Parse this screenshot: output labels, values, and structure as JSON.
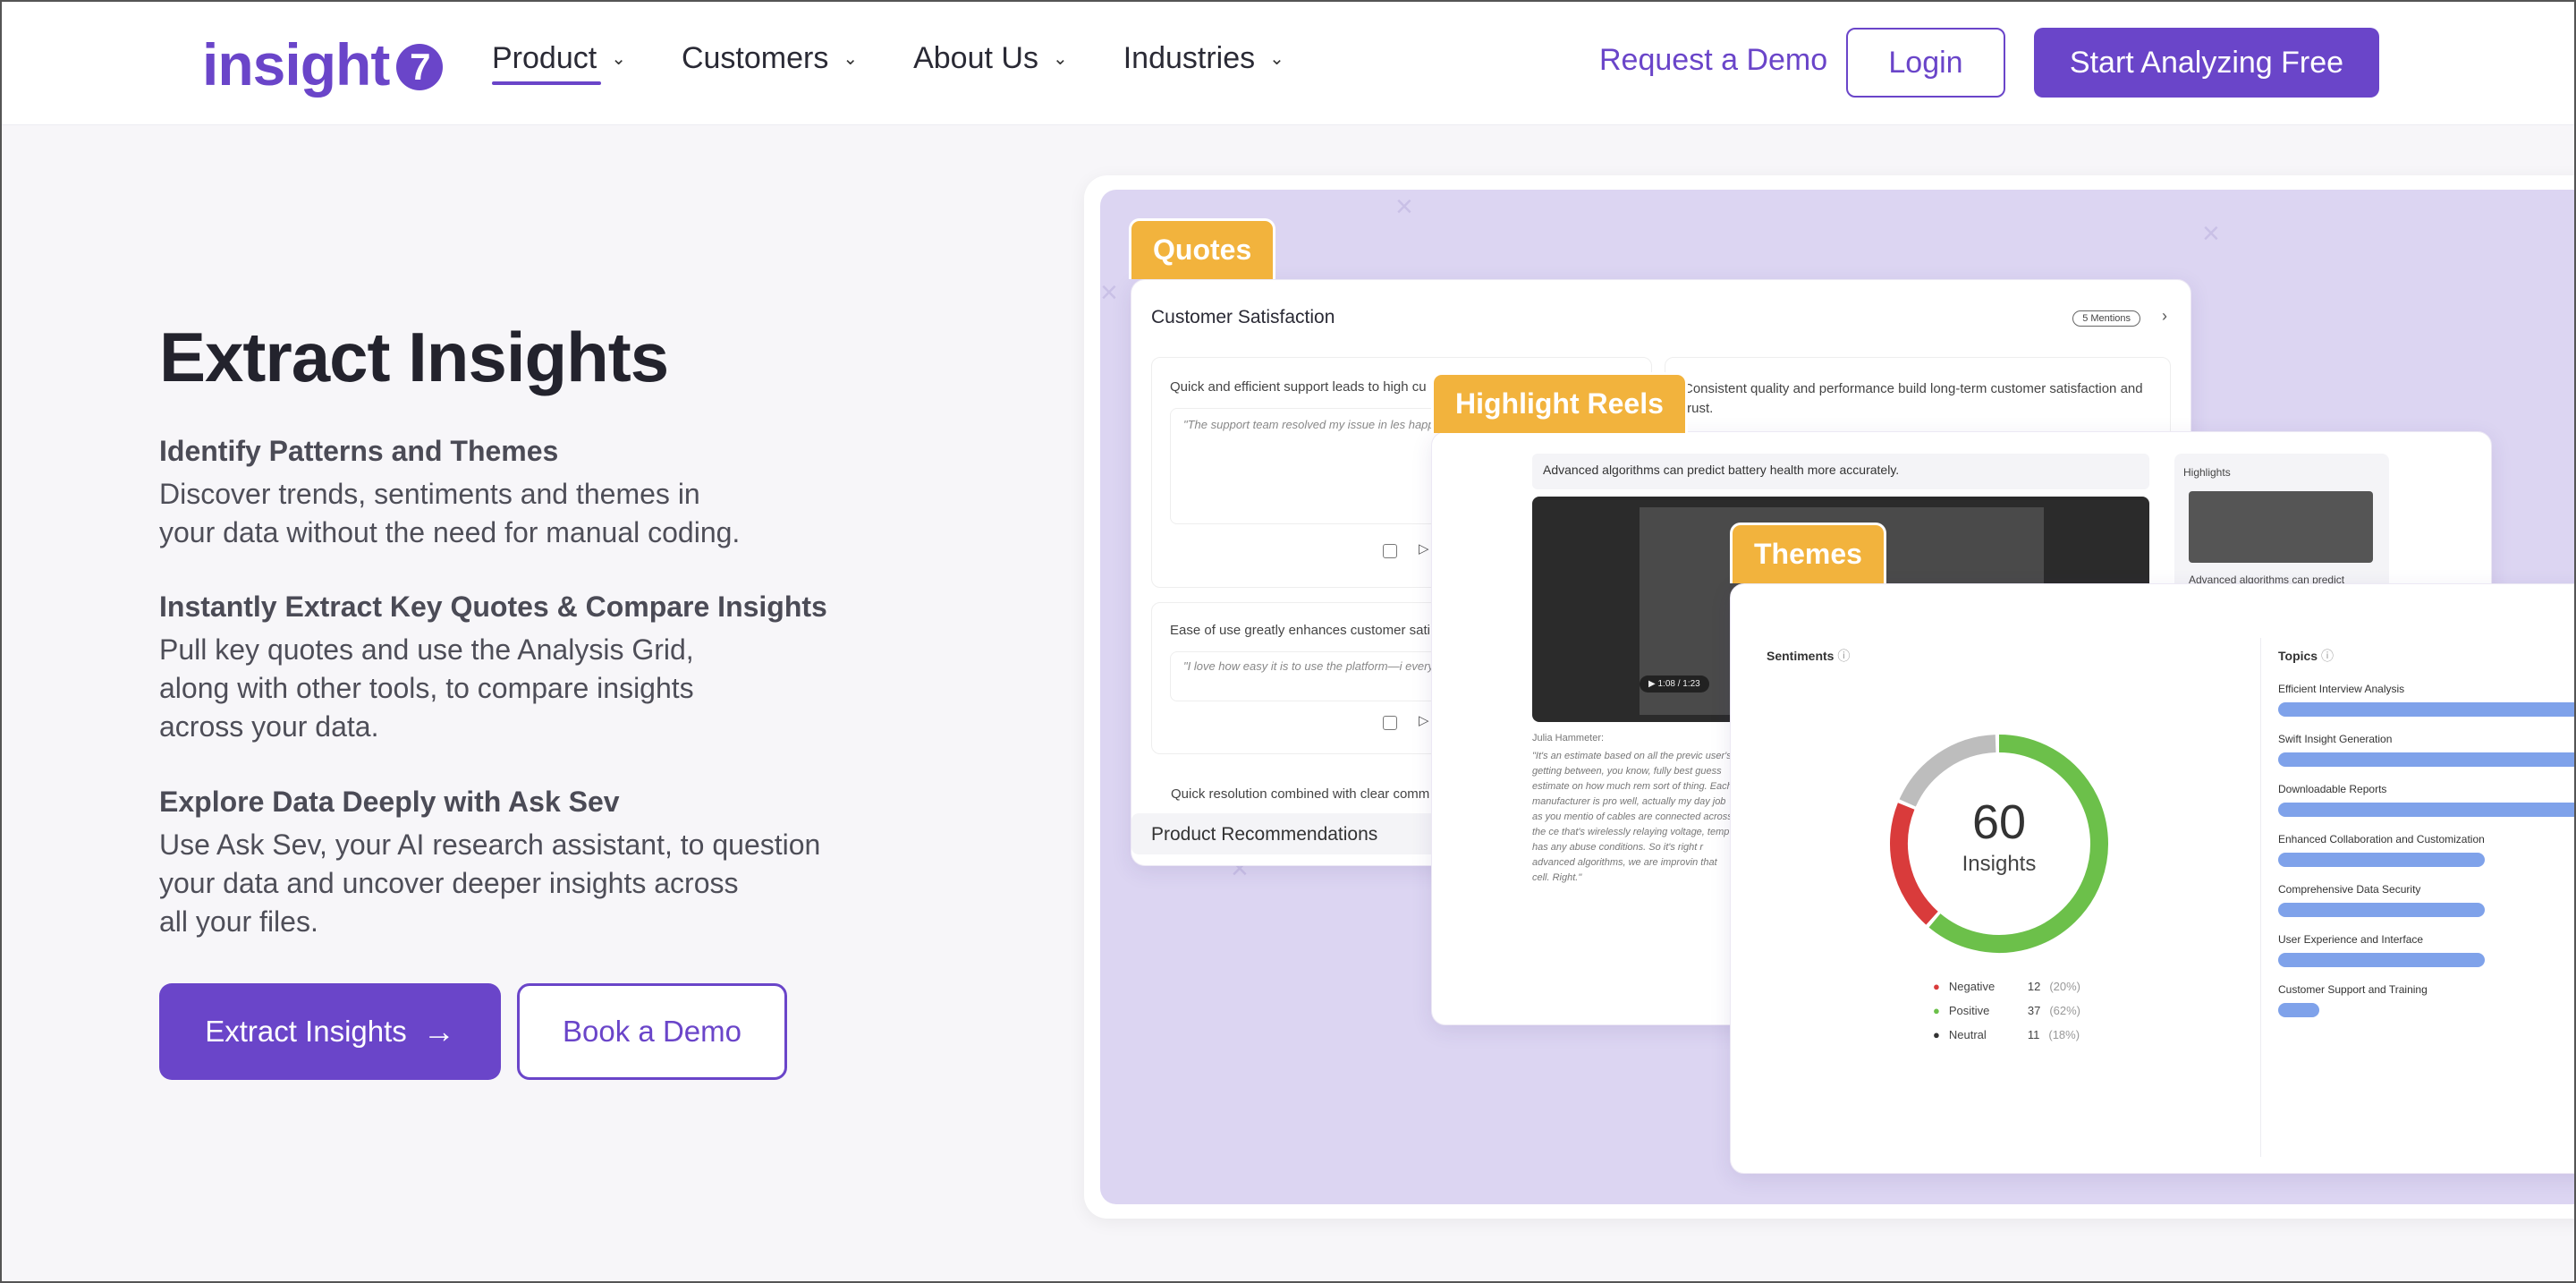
{
  "header": {
    "logo_text": "insight",
    "logo_mark": "7",
    "nav": [
      {
        "label": "Product"
      },
      {
        "label": "Customers"
      },
      {
        "label": "About Us"
      },
      {
        "label": "Industries"
      }
    ],
    "request_demo": "Request a Demo",
    "login": "Login",
    "start": "Start Analyzing Free"
  },
  "hero": {
    "title": "Extract Insights",
    "features": [
      {
        "heading": "Identify Patterns and Themes",
        "body": "Discover trends, sentiments and themes in\nyour data without the need for manual coding."
      },
      {
        "heading": "Instantly Extract Key Quotes & Compare Insights",
        "body": "Pull key quotes and use the Analysis Grid,\nalong with other tools, to compare insights\nacross your data."
      },
      {
        "heading": "Explore Data Deeply with Ask Sev",
        "body": "Use Ask Sev, your AI research assistant, to question\nyour data and uncover deeper insights across\nall your files."
      }
    ],
    "cta_primary": "Extract Insights",
    "cta_secondary": "Book a Demo"
  },
  "quotes_card": {
    "tab": "Quotes",
    "title": "Customer Satisfaction",
    "mentions": "5 Mentions",
    "q1_title": "Quick and efficient support leads to high cu",
    "q1_quote": "\"The support team resolved my issue in les happier with the service!\"",
    "q2_title": "Consistent quality and performance build long-term customer satisfaction and trust.",
    "q3_title": "Ease of use greatly enhances customer sati",
    "q3_quote": "\"I love how easy it is to use the platform—i every day.\"",
    "q4_title": "Quick resolution combined with clear comm",
    "footer": "Product Recommendations"
  },
  "reels_card": {
    "tab": "Highlight Reels",
    "caption": "Advanced algorithms can predict battery health more accurately.",
    "side_title": "Highlights",
    "side_caption": "Advanced algorithms can predict",
    "video_time": "1:08 / 1:23",
    "speaker": "Julia Hammeter:",
    "transcript": "\"It's an estimate based on all the previc user's getting between, you know, fully best guess estimate on how much rem sort of thing. Each manufacturer is pro well, actually my day job as you mentio of cables are connected across the ce that's wirelessly relaying voltage, temp has any abuse conditions. So it's right r advanced algorithms, we are improvin that cell. Right.\""
  },
  "themes_card": {
    "tab": "Themes",
    "sentiments_label": "Sentiments",
    "topics_label": "Topics",
    "donut_value": "60",
    "donut_label": "Insights",
    "legend": [
      {
        "label": "Negative",
        "count": "12",
        "pct": "(20%)",
        "color": "#d93b3b"
      },
      {
        "label": "Positive",
        "count": "37",
        "pct": "(62%)",
        "color": "#6cc04a"
      },
      {
        "label": "Neutral",
        "count": "11",
        "pct": "(18%)",
        "color": "#bdbdbd"
      }
    ],
    "topics": [
      {
        "label": "Efficient Interview Analysis",
        "fill": 1.0
      },
      {
        "label": "Swift Insight Generation",
        "fill": 1.0
      },
      {
        "label": "Downloadable Reports",
        "fill": 1.0
      },
      {
        "label": "Enhanced Collaboration and Customization",
        "fill": 0.55
      },
      {
        "label": "Comprehensive Data Security",
        "fill": 0.55
      },
      {
        "label": "User Experience and Interface",
        "fill": 0.55
      },
      {
        "label": "Customer Support and Training",
        "fill": 0.11
      }
    ]
  },
  "colors": {
    "brand": "#6a45c9",
    "tab_orange": "#f2b33d",
    "panel_bg": "#dcd5f2"
  }
}
